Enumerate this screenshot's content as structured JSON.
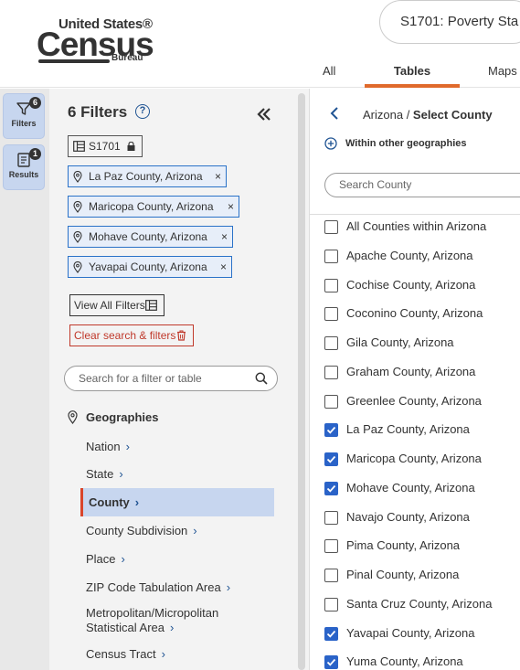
{
  "header": {
    "logo": {
      "line1": "United States®",
      "line2": "Census",
      "line3": "Bureau"
    },
    "search_value": "S1701: Poverty Sta",
    "tabs": [
      {
        "label": "All"
      },
      {
        "label": "Tables"
      },
      {
        "label": "Maps"
      }
    ],
    "active_tab": "Tables",
    "accent_color": "#e06a2c"
  },
  "rail": {
    "filters_label": "Filters",
    "filters_badge": "6",
    "results_label": "Results",
    "results_badge": "1"
  },
  "filters": {
    "title": "6 Filters",
    "help": "?",
    "table_chip": "S1701",
    "chips": [
      {
        "label": "La Paz County, Arizona",
        "remove": "×"
      },
      {
        "label": "Maricopa County, Arizona",
        "remove": "×"
      },
      {
        "label": "Mohave County, Arizona",
        "remove": "×"
      },
      {
        "label": "Yavapai County, Arizona",
        "remove": "×"
      }
    ],
    "view_all_label": "View All Filters",
    "clear_label": "Clear search & filters",
    "search_placeholder": "Search for a filter or table",
    "geographies_heading": "Geographies",
    "geo_items": [
      {
        "label": "Nation",
        "chev": "›"
      },
      {
        "label": "State",
        "chev": "›"
      },
      {
        "label": "County",
        "chev": "›"
      },
      {
        "label": "County Subdivision",
        "chev": "›"
      },
      {
        "label": "Place",
        "chev": "›"
      },
      {
        "label": "ZIP Code Tabulation Area",
        "chev": "›"
      },
      {
        "label": "Metropolitan/Micropolitan",
        "label2": "Statistical Area",
        "chev": "›"
      },
      {
        "label": "Census Tract",
        "chev": "›"
      }
    ],
    "selected_geo": "County"
  },
  "county_panel": {
    "crumb_parent": "Arizona",
    "crumb_sep": " / ",
    "crumb_current": "Select County",
    "within_label": "Within other geographies",
    "search_placeholder": "Search County",
    "items": [
      {
        "label": "All Counties within Arizona",
        "checked": false
      },
      {
        "label": "Apache County, Arizona",
        "checked": false
      },
      {
        "label": "Cochise County, Arizona",
        "checked": false
      },
      {
        "label": "Coconino County, Arizona",
        "checked": false
      },
      {
        "label": "Gila County, Arizona",
        "checked": false
      },
      {
        "label": "Graham County, Arizona",
        "checked": false
      },
      {
        "label": "Greenlee County, Arizona",
        "checked": false
      },
      {
        "label": "La Paz County, Arizona",
        "checked": true
      },
      {
        "label": "Maricopa County, Arizona",
        "checked": true
      },
      {
        "label": "Mohave County, Arizona",
        "checked": true
      },
      {
        "label": "Navajo County, Arizona",
        "checked": false
      },
      {
        "label": "Pima County, Arizona",
        "checked": false
      },
      {
        "label": "Pinal County, Arizona",
        "checked": false
      },
      {
        "label": "Santa Cruz County, Arizona",
        "checked": false
      },
      {
        "label": "Yavapai County, Arizona",
        "checked": true
      },
      {
        "label": "Yuma County, Arizona",
        "checked": true
      }
    ]
  }
}
